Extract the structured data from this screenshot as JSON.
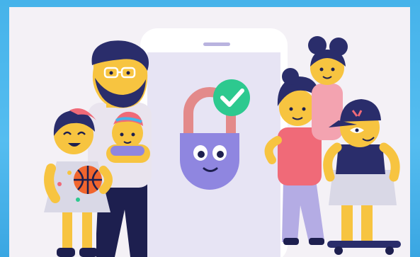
{
  "scene": {
    "colors": {
      "frame": "#46b3ea",
      "panel": "#f4f1f6",
      "phone": "#e7e4f4",
      "lock_body": "#8f86e0",
      "lock_shackle": "#e38a8a",
      "check_badge": "#2dc98f",
      "skin": "#f7c440",
      "hair": "#2a2d6b",
      "pink_shirt": "#f06a78",
      "lilac_pants": "#b4ace4",
      "cap": "#2a2d6b",
      "skateboard": "#2a2d6b",
      "ball": "#f0652e"
    },
    "icons": [
      "check-icon",
      "padlock-icon"
    ]
  }
}
